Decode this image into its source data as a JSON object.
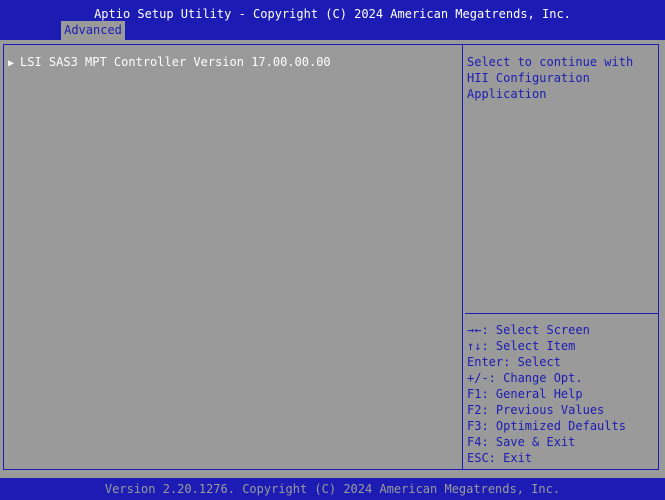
{
  "header": {
    "title": "Aptio Setup Utility - Copyright (C) 2024 American Megatrends, Inc.",
    "tabs": [
      {
        "label": "Advanced"
      }
    ]
  },
  "menu": {
    "items": [
      {
        "label": "LSI SAS3 MPT Controller Version 17.00.00.00",
        "icon": "triangle-right-icon"
      }
    ]
  },
  "help": {
    "text": "Select to continue with HII Configuration Application"
  },
  "keys": [
    {
      "text": "→←: Select Screen"
    },
    {
      "text": "↑↓: Select Item"
    },
    {
      "text": "Enter: Select"
    },
    {
      "text": "+/-: Change Opt."
    },
    {
      "text": "F1: General Help"
    },
    {
      "text": "F2: Previous Values"
    },
    {
      "text": "F3: Optimized Defaults"
    },
    {
      "text": "F4: Save & Exit"
    },
    {
      "text": "ESC: Exit"
    }
  ],
  "footer": {
    "text": "Version 2.20.1276. Copyright (C) 2024 American Megatrends, Inc."
  },
  "colors": {
    "background": "#9a9a9a",
    "accent": "#1c1cb4",
    "text_white": "#ffffff"
  }
}
